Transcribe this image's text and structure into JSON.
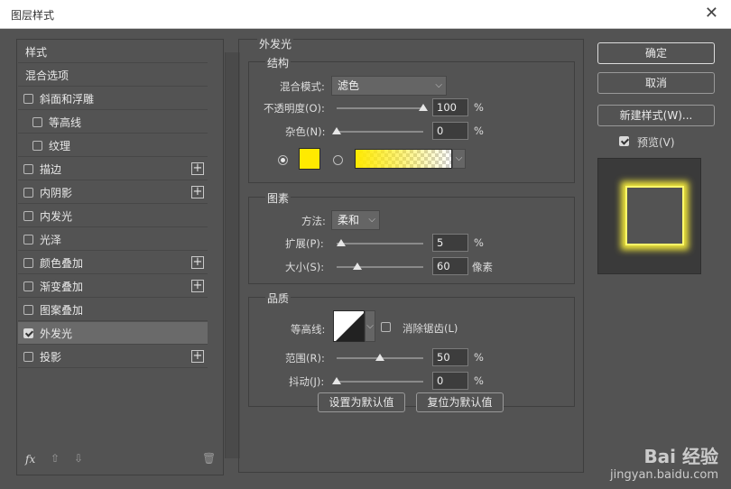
{
  "window": {
    "title": "图层样式",
    "close_glyph": "✕"
  },
  "styles_list": {
    "items": [
      {
        "label": "样式",
        "checkbox": false,
        "checked": false,
        "plus": false,
        "selected": false
      },
      {
        "label": "混合选项",
        "checkbox": false,
        "checked": false,
        "plus": false,
        "selected": false
      },
      {
        "label": "斜面和浮雕",
        "checkbox": true,
        "checked": false,
        "plus": false,
        "selected": false
      },
      {
        "label": "等高线",
        "checkbox": true,
        "checked": false,
        "plus": false,
        "selected": false
      },
      {
        "label": "纹理",
        "checkbox": true,
        "checked": false,
        "plus": false,
        "selected": false
      },
      {
        "label": "描边",
        "checkbox": true,
        "checked": false,
        "plus": true,
        "selected": false
      },
      {
        "label": "内阴影",
        "checkbox": true,
        "checked": false,
        "plus": true,
        "selected": false
      },
      {
        "label": "内发光",
        "checkbox": true,
        "checked": false,
        "plus": false,
        "selected": false
      },
      {
        "label": "光泽",
        "checkbox": true,
        "checked": false,
        "plus": false,
        "selected": false
      },
      {
        "label": "颜色叠加",
        "checkbox": true,
        "checked": false,
        "plus": true,
        "selected": false
      },
      {
        "label": "渐变叠加",
        "checkbox": true,
        "checked": false,
        "plus": true,
        "selected": false
      },
      {
        "label": "图案叠加",
        "checkbox": true,
        "checked": false,
        "plus": false,
        "selected": false
      },
      {
        "label": "外发光",
        "checkbox": true,
        "checked": true,
        "plus": false,
        "selected": true
      },
      {
        "label": "投影",
        "checkbox": true,
        "checked": false,
        "plus": true,
        "selected": false
      }
    ],
    "footer": {
      "fx_label": "fx",
      "up_glyph": "⇧",
      "down_glyph": "⇩",
      "trash_glyph": "🗑"
    }
  },
  "outer_glow": {
    "title": "外发光",
    "structure": {
      "title": "结构",
      "blend_mode_label": "混合模式:",
      "blend_mode_value": "滤色",
      "opacity_label": "不透明度(O):",
      "opacity_value": "100",
      "opacity_unit": "%",
      "opacity_fraction": 1.0,
      "noise_label": "杂色(N):",
      "noise_value": "0",
      "noise_unit": "%",
      "noise_fraction": 0.0,
      "color_swatch": "#ffea00",
      "gradient_from": "#ffea00"
    },
    "elements": {
      "title": "图素",
      "method_label": "方法:",
      "method_value": "柔和",
      "spread_label": "扩展(P):",
      "spread_value": "5",
      "spread_unit": "%",
      "spread_fraction": 0.05,
      "size_label": "大小(S):",
      "size_value": "60",
      "size_unit": "像素",
      "size_fraction": 0.24
    },
    "quality": {
      "title": "品质",
      "contour_label": "等高线:",
      "antialias_label": "消除锯齿(L)",
      "antialias_checked": false,
      "range_label": "范围(R):",
      "range_value": "50",
      "range_unit": "%",
      "range_fraction": 0.5,
      "jitter_label": "抖动(J):",
      "jitter_value": "0",
      "jitter_unit": "%",
      "jitter_fraction": 0.0
    },
    "set_default_label": "设置为默认值",
    "reset_default_label": "复位为默认值"
  },
  "actions": {
    "ok_label": "确定",
    "cancel_label": "取消",
    "new_style_label": "新建样式(W)...",
    "preview_label": "预览(V)",
    "preview_checked": true
  },
  "watermark": {
    "brand": "Bai 经验",
    "url": "jingyan.baidu.com"
  }
}
